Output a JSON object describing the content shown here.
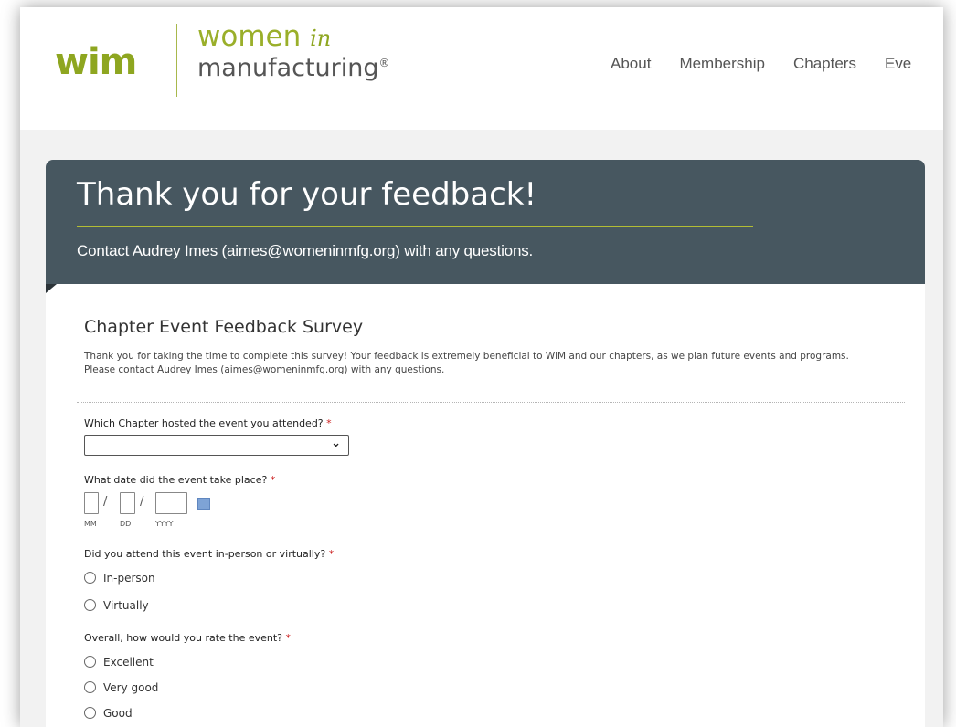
{
  "header": {
    "logo_mark": "wim",
    "logo_line1": "women",
    "logo_in": "in",
    "logo_line2": "manufacturing",
    "logo_reg": "®",
    "nav": [
      "About",
      "Membership",
      "Chapters",
      "Eve"
    ]
  },
  "banner": {
    "title": "Thank you for your feedback!",
    "subtitle": "Contact Audrey Imes (aimes@womeninmfg.org) with any questions."
  },
  "form": {
    "title": "Chapter Event Feedback Survey",
    "description": "Thank you for taking the time to complete this survey! Your feedback is extremely beneficial to WiM and our chapters, as we plan future events and programs. Please contact Audrey Imes (aimes@womeninmfg.org) with any questions.",
    "required_mark": "*",
    "q1": {
      "label": "Which Chapter hosted the event you attended?",
      "selected": "",
      "chevron_icon": "chevron-down-icon"
    },
    "q2": {
      "label": "What date did the event take place?",
      "hints": [
        "MM",
        "DD",
        "YYYY"
      ],
      "separator": "/",
      "calendar_icon": "calendar-icon"
    },
    "q3": {
      "label": "Did you attend this event in-person or virtually?",
      "options": [
        "In-person",
        "Virtually"
      ]
    },
    "q4": {
      "label": "Overall, how would you rate the event?",
      "options": [
        "Excellent",
        "Very good",
        "Good"
      ]
    }
  },
  "colors": {
    "brand_green": "#8ea620",
    "banner_bg": "#475760",
    "banner_rule": "#b3bd34",
    "page_bg": "#f2f2f2",
    "required": "#cc2222"
  }
}
